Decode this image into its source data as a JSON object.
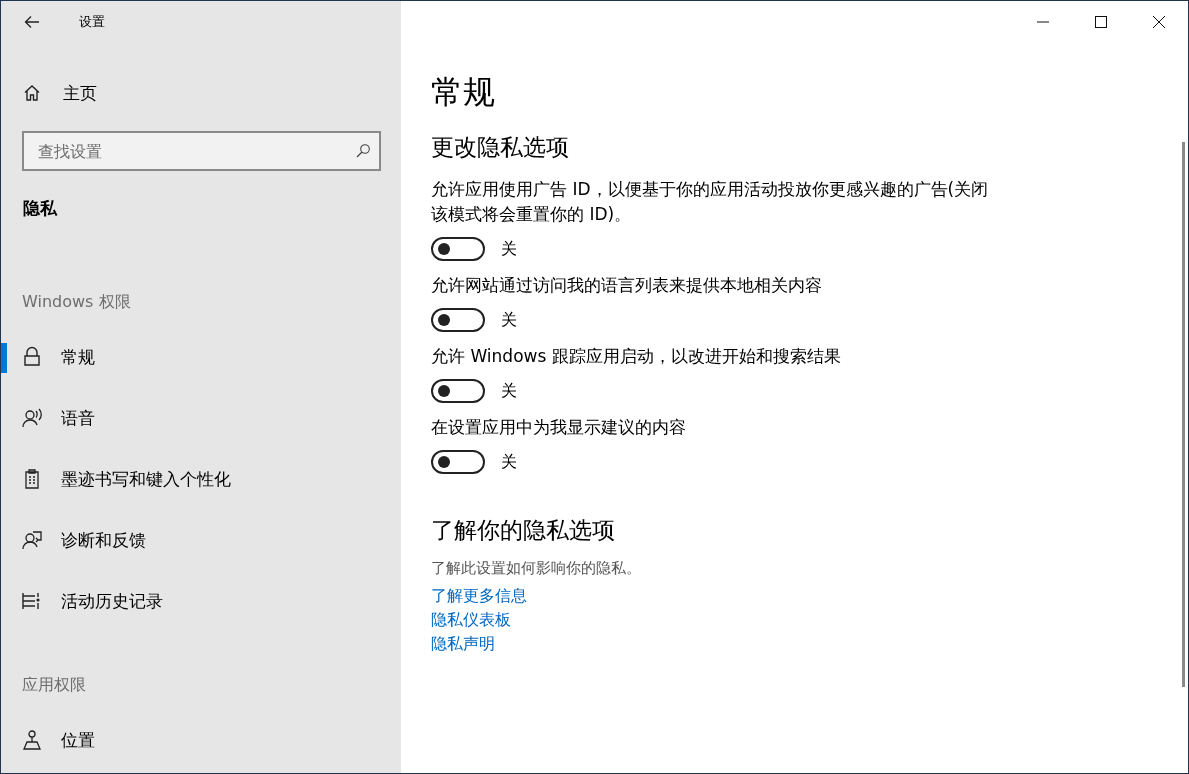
{
  "window": {
    "title": "设置"
  },
  "sidebar": {
    "home": "主页",
    "search": {
      "placeholder": "查找设置"
    },
    "section": "隐私",
    "groups": [
      {
        "heading": "Windows 权限",
        "items": [
          {
            "label": "常规",
            "selected": true
          },
          {
            "label": "语音",
            "selected": false
          },
          {
            "label": "墨迹书写和键入个性化",
            "selected": false
          },
          {
            "label": "诊断和反馈",
            "selected": false
          },
          {
            "label": "活动历史记录",
            "selected": false
          }
        ]
      },
      {
        "heading": "应用权限",
        "items": [
          {
            "label": "位置",
            "selected": false
          }
        ]
      }
    ]
  },
  "content": {
    "title": "常规",
    "heading": "更改隐私选项",
    "settings": [
      {
        "label": "允许应用使用广告 ID，以便基于你的应用活动投放你更感兴趣的广告(关闭该模式将会重置你的 ID)。",
        "on": false,
        "state_label": "关"
      },
      {
        "label": "允许网站通过访问我的语言列表来提供本地相关内容",
        "on": false,
        "state_label": "关"
      },
      {
        "label": "允许 Windows 跟踪应用启动，以改进开始和搜索结果",
        "on": false,
        "state_label": "关"
      },
      {
        "label": "在设置应用中为我显示建议的内容",
        "on": false,
        "state_label": "关"
      }
    ],
    "learn": {
      "heading": "了解你的隐私选项",
      "text": "了解此设置如何影响你的隐私。",
      "links": [
        "了解更多信息",
        "隐私仪表板",
        "隐私声明"
      ]
    }
  }
}
